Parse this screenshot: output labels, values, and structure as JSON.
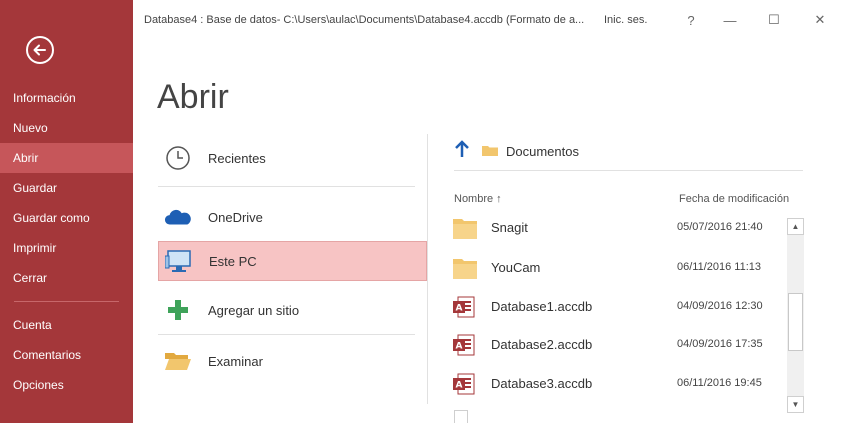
{
  "window": {
    "title": "Database4 : Base de datos- C:\\Users\\aulac\\Documents\\Database4.accdb (Formato de a...",
    "signin": "Inic. ses.",
    "help": "?",
    "minimize": "—",
    "maximize": "☐",
    "close": "✕"
  },
  "sidebar": {
    "items": [
      {
        "label": "Información"
      },
      {
        "label": "Nuevo"
      },
      {
        "label": "Abrir",
        "active": true
      },
      {
        "label": "Guardar"
      },
      {
        "label": "Guardar como"
      },
      {
        "label": "Imprimir"
      },
      {
        "label": "Cerrar"
      },
      {
        "label": "Cuenta"
      },
      {
        "label": "Comentarios"
      },
      {
        "label": "Opciones"
      }
    ]
  },
  "page": {
    "title": "Abrir"
  },
  "locations": [
    {
      "label": "Recientes",
      "icon": "clock-icon"
    },
    {
      "label": "OneDrive",
      "icon": "cloud-icon"
    },
    {
      "label": "Este PC",
      "icon": "computer-icon",
      "selected": true
    },
    {
      "label": "Agregar un sitio",
      "icon": "plus-icon"
    },
    {
      "label": "Examinar",
      "icon": "folder-open-icon"
    }
  ],
  "pane": {
    "path_label": "Documentos",
    "col_name": "Nombre ↑",
    "col_date": "Fecha de modificación",
    "files": [
      {
        "name": "Snagit",
        "date": "05/07/2016 21:40",
        "type": "folder"
      },
      {
        "name": "YouCam",
        "date": "06/11/2016 11:13",
        "type": "folder"
      },
      {
        "name": "Database1.accdb",
        "date": "04/09/2016 12:30",
        "type": "access"
      },
      {
        "name": "Database2.accdb",
        "date": "04/09/2016 17:35",
        "type": "access"
      },
      {
        "name": "Database3.accdb",
        "date": "06/11/2016 19:45",
        "type": "access"
      }
    ]
  },
  "colors": {
    "sidebar": "#a4373a",
    "sidebar_active": "#c6565a",
    "selected_location": "#f7c4c4",
    "access_red": "#a4373a",
    "folder": "#f2c66d"
  }
}
